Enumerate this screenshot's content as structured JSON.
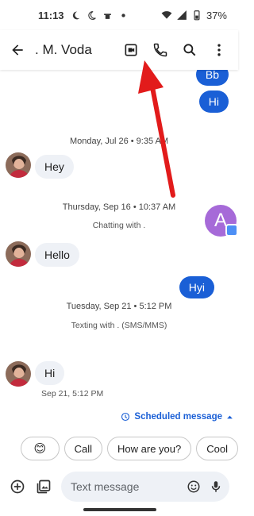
{
  "status_bar": {
    "time": "11:13",
    "battery": "37%"
  },
  "app_bar": {
    "contact_name": ". M. Voda"
  },
  "thread": {
    "partial_bubble": "Bb",
    "out_hi": "Hi",
    "divider_1": "Monday, Jul 26 • 9:35 AM",
    "in_hey": "Hey",
    "divider_2": "Thursday, Sep 16 • 10:37 AM",
    "chatting_with": "Chatting with .",
    "in_hello": "Hello",
    "out_hyi": "Hyi",
    "contact_avatar_letter": "A",
    "divider_3": "Tuesday, Sep 21 • 5:12 PM",
    "texting_with": "Texting with . (SMS/MMS)",
    "in_hi": "Hi",
    "in_hi_meta": "Sep 21, 5:12 PM"
  },
  "scheduled": {
    "label": "Scheduled message"
  },
  "chips": [
    "😊",
    "Call",
    "How are you?",
    "Cool"
  ],
  "compose": {
    "placeholder": "Text message"
  },
  "colors": {
    "accent": "#1a5fd6",
    "incoming_bubble": "#eef1f6",
    "annotation_arrow": "#e21b1b",
    "avatar": "#a66ad8"
  }
}
